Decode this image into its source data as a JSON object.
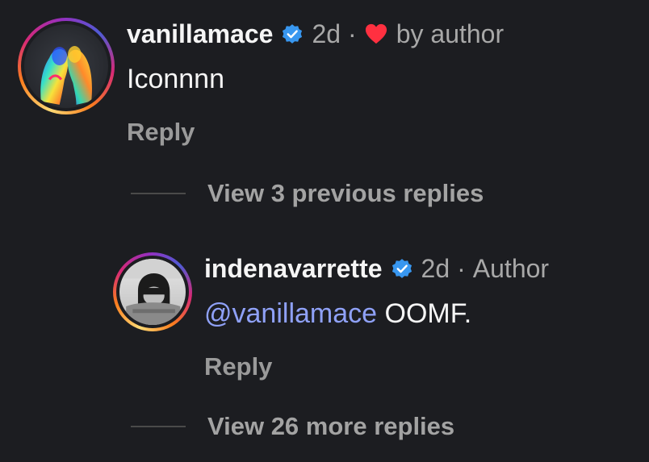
{
  "comment": {
    "username": "vanillamace",
    "time": "2d",
    "separator": "·",
    "liked_by": "by author",
    "text": "Iconnnn",
    "reply_label": "Reply",
    "verified_icon": "verified-badge-icon",
    "heart_icon": "heart-icon",
    "heart_color": "#ff3040"
  },
  "view_previous": {
    "label": "View 3 previous replies"
  },
  "reply": {
    "username": "indenavarrette",
    "time": "2d",
    "separator": "·",
    "author_tag": "Author",
    "mention": "@vanillamace",
    "text": " OOMF.",
    "reply_label": "Reply",
    "verified_icon": "verified-badge-icon"
  },
  "view_more": {
    "label": "View 26 more replies"
  },
  "colors": {
    "background": "#1c1d21",
    "verified_blue": "#3897f0",
    "mention": "#8fa1f7",
    "muted_text": "#a8a8a8"
  }
}
